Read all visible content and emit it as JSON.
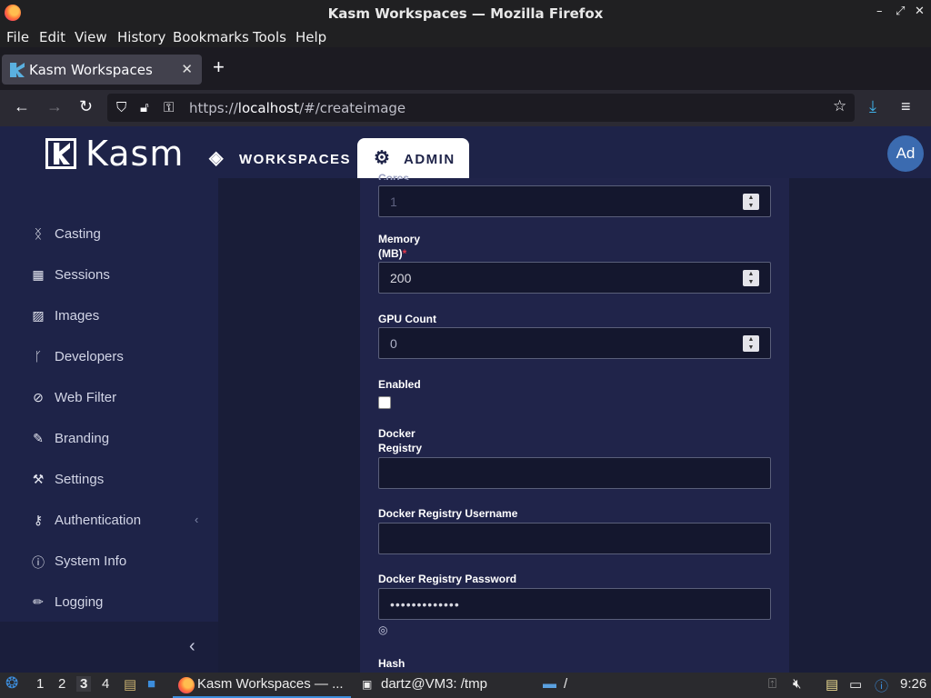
{
  "window": {
    "title": "Kasm Workspaces — Mozilla Firefox"
  },
  "menubar": {
    "items": [
      "File",
      "Edit",
      "View",
      "History",
      "Bookmarks",
      "Tools",
      "Help"
    ]
  },
  "browser": {
    "tab_title": "Kasm Workspaces",
    "url_prefix": "https://",
    "url_host": "localhost",
    "url_path": "/#/createimage"
  },
  "header": {
    "logo_text": "Kasm",
    "nav": [
      {
        "label": "WORKSPACES"
      },
      {
        "label": "ADMIN"
      }
    ],
    "avatar_initials": "Ad"
  },
  "sidebar": {
    "items": [
      {
        "label": "Casting",
        "icon": "casting-icon"
      },
      {
        "label": "Sessions",
        "icon": "table-icon"
      },
      {
        "label": "Images",
        "icon": "image-icon"
      },
      {
        "label": "Developers",
        "icon": "branch-icon"
      },
      {
        "label": "Web Filter",
        "icon": "ban-icon"
      },
      {
        "label": "Branding",
        "icon": "brush-icon"
      },
      {
        "label": "Settings",
        "icon": "wrench-icon"
      },
      {
        "label": "Authentication",
        "icon": "key-icon"
      },
      {
        "label": "System Info",
        "icon": "info-icon"
      },
      {
        "label": "Logging",
        "icon": "pencil-icon"
      }
    ]
  },
  "form": {
    "cores_label": "Cores",
    "cores_value": "1",
    "memory_label_line1": "Memory",
    "memory_label_line2": "(MB)",
    "memory_required_mark": "*",
    "memory_value": "200",
    "gpu_label": "GPU Count",
    "gpu_value": "0",
    "enabled_label": "Enabled",
    "docker_registry_label_line1": "Docker",
    "docker_registry_label_line2": "Registry",
    "docker_registry_value": "",
    "registry_username_label": "Docker Registry Username",
    "registry_username_value": "",
    "registry_password_label": "Docker Registry Password",
    "registry_password_value": "•••••••••••••",
    "hash_label": "Hash"
  },
  "taskbar": {
    "workspaces": [
      "1",
      "2",
      "3",
      "4"
    ],
    "active_task": "Kasm Workspaces — ...",
    "terminal_task": "dartz@VM3: /tmp",
    "files_task": "/",
    "clock": "9:26"
  }
}
